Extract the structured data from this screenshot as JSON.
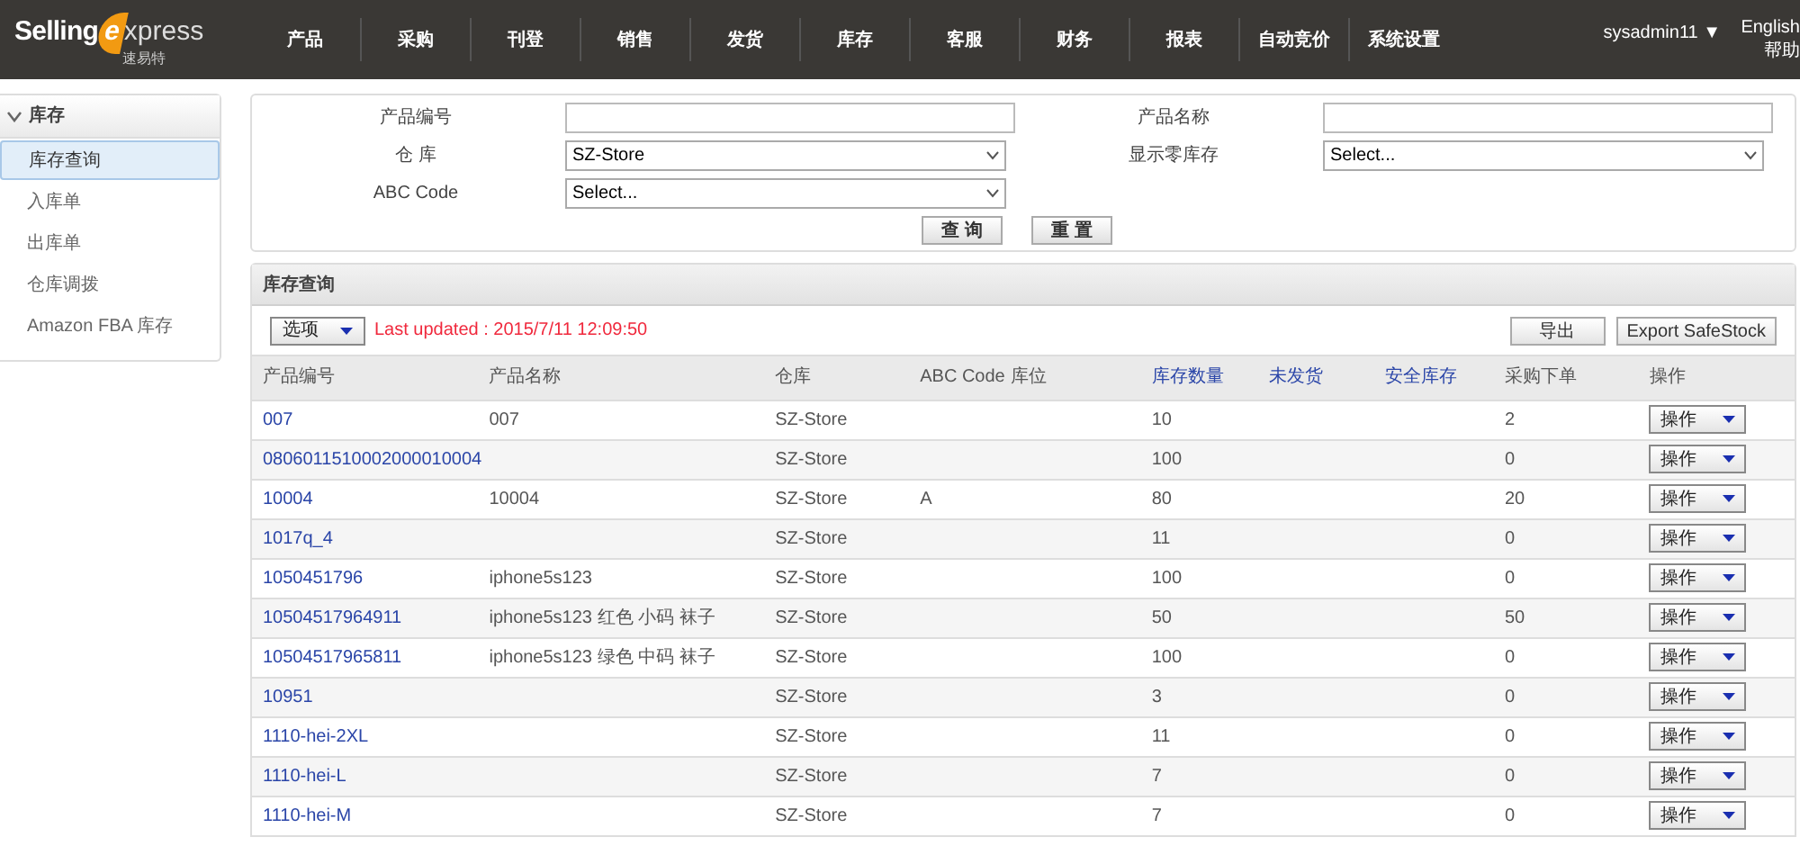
{
  "logo": {
    "part_1": "Selling",
    "part_2": "e",
    "part_3": "xpress",
    "subtitle": "速易特"
  },
  "nav": [
    "产品",
    "采购",
    "刊登",
    "销售",
    "发货",
    "库存",
    "客服",
    "财务",
    "报表",
    "自动竞价",
    "系统设置"
  ],
  "user": {
    "name": "sysadmin11 ▼",
    "language": "English",
    "help": "帮助"
  },
  "sidebar": {
    "title": "库存",
    "expanded": true,
    "items": [
      {
        "label": "库存查询",
        "selected": true
      },
      {
        "label": "入库单",
        "selected": false
      },
      {
        "label": "出库单",
        "selected": false
      },
      {
        "label": "仓库调拨",
        "selected": false
      },
      {
        "label": "Amazon FBA 库存",
        "selected": false
      }
    ]
  },
  "search": {
    "fields": [
      {
        "label": "产品编号",
        "kind": "text"
      },
      {
        "label": "产品名称",
        "kind": "text"
      },
      {
        "label": "仓 库",
        "kind": "select",
        "value": "SZ-Store"
      },
      {
        "label": "显示零库存",
        "kind": "select",
        "value": "Select..."
      },
      {
        "label": "ABC Code",
        "kind": "select",
        "value": "Select..."
      }
    ],
    "buttons": [
      "查 询",
      "重 置"
    ]
  },
  "results": {
    "title": "库存查询",
    "options": "选项",
    "last_updated": "Last updated : 2015/7/11 12:09:50",
    "buttons": [
      "导出",
      "Export SafeStock"
    ],
    "columns": [
      {
        "label": "产品编号",
        "sortable": false
      },
      {
        "label": "产品名称",
        "sortable": false
      },
      {
        "label": "仓库",
        "sortable": false
      },
      {
        "label": "ABC Code",
        "sortable": false
      },
      {
        "label": "库位",
        "sortable": false
      },
      {
        "label": "库存数量",
        "sortable": true
      },
      {
        "label": "未发货",
        "sortable": true
      },
      {
        "label": "安全库存",
        "sortable": true
      },
      {
        "label": "采购下单",
        "sortable": false
      },
      {
        "label": "操作",
        "sortable": false
      }
    ],
    "rows": [
      {
        "code": "007",
        "name": "007",
        "warehouse": "SZ-Store",
        "stock": "10",
        "purchase": "2",
        "action": "操作"
      },
      {
        "code": "0806011510002000010004",
        "warehouse": "SZ-Store",
        "stock": "100",
        "purchase": "0",
        "action": "操作"
      },
      {
        "code": "10004",
        "name": "10004",
        "warehouse": "SZ-Store",
        "abc": "A",
        "stock": "80",
        "purchase": "20",
        "action": "操作"
      },
      {
        "code": "1017q_4",
        "warehouse": "SZ-Store",
        "stock": "11",
        "purchase": "0",
        "action": "操作"
      },
      {
        "code": "1050451796",
        "name": "iphone5s123",
        "warehouse": "SZ-Store",
        "stock": "100",
        "purchase": "0",
        "action": "操作"
      },
      {
        "code": "10504517964911",
        "name": "iphone5s123 红色 小码 袜子",
        "warehouse": "SZ-Store",
        "stock": "50",
        "purchase": "50",
        "action": "操作"
      },
      {
        "code": "10504517965811",
        "name": "iphone5s123 绿色 中码 袜子",
        "warehouse": "SZ-Store",
        "stock": "100",
        "purchase": "0",
        "action": "操作"
      },
      {
        "code": "10951",
        "warehouse": "SZ-Store",
        "stock": "3",
        "purchase": "0",
        "action": "操作"
      },
      {
        "code": "1110-hei-2XL",
        "warehouse": "SZ-Store",
        "stock": "11",
        "purchase": "0",
        "action": "操作"
      },
      {
        "code": "1110-hei-L",
        "warehouse": "SZ-Store",
        "stock": "7",
        "purchase": "0",
        "action": "操作"
      },
      {
        "code": "1110-hei-M",
        "warehouse": "SZ-Store",
        "stock": "7",
        "purchase": "0",
        "action": "操作"
      }
    ]
  }
}
